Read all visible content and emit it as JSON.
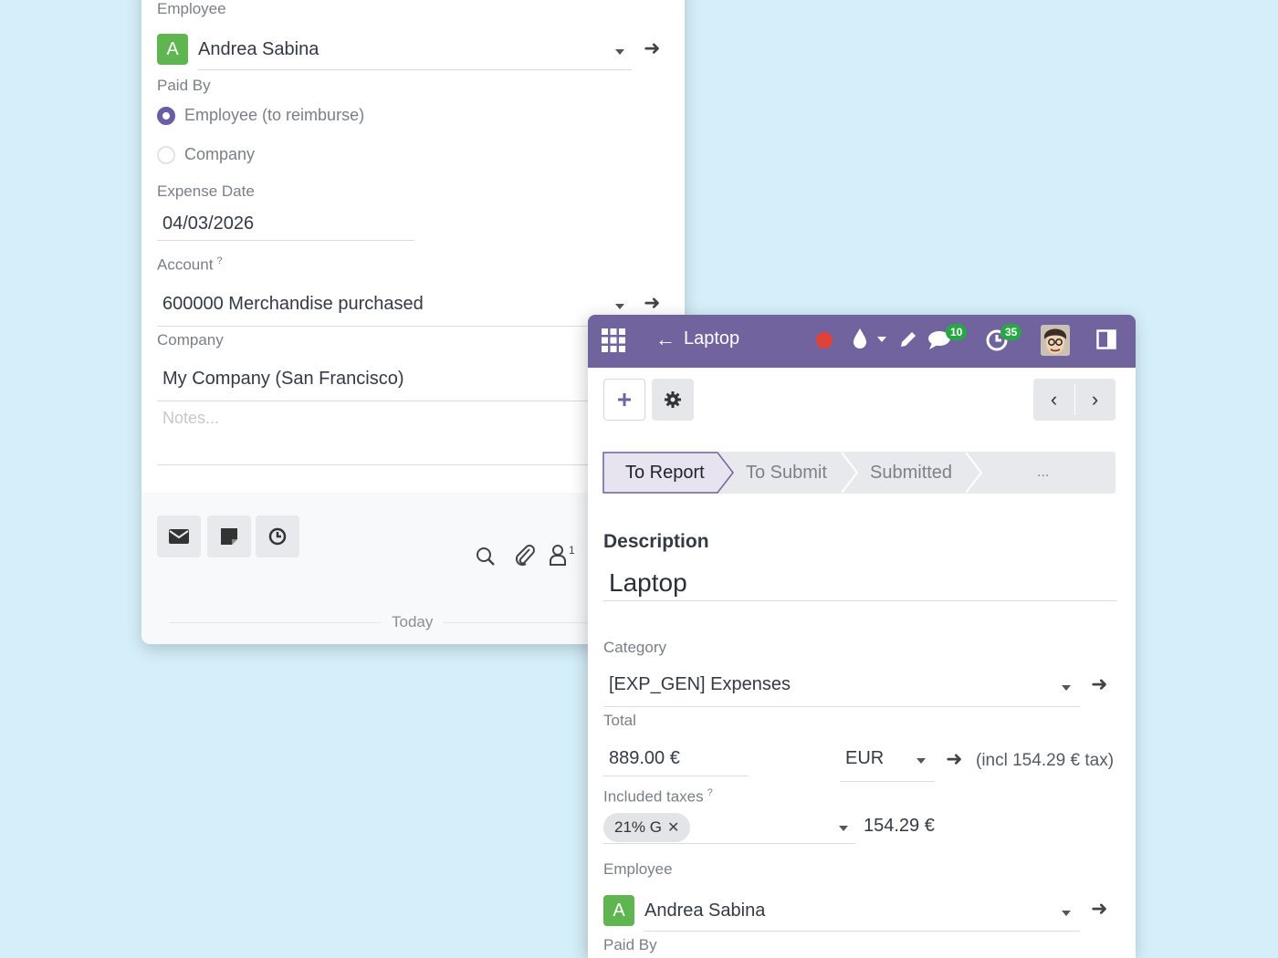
{
  "back": {
    "employee_label": "Employee",
    "employee_initial": "A",
    "employee_value": "Andrea Sabina",
    "paid_by_label": "Paid By",
    "paid_by_options": [
      "Employee (to reimburse)",
      "Company"
    ],
    "expense_date_label": "Expense Date",
    "expense_date_value": "04/03/2026",
    "account_label": "Account",
    "account_help": "?",
    "account_value": "600000 Merchandise purchased",
    "company_label": "Company",
    "company_value": "My Company (San Francisco)",
    "notes_placeholder": "Notes...",
    "follower_count": "1",
    "today_label": "Today"
  },
  "front": {
    "breadcrumb": "Laptop",
    "messages_count": "10",
    "activities_count": "35",
    "statuses": [
      "To Report",
      "To Submit",
      "Submitted",
      "..."
    ],
    "description_label": "Description",
    "description_value": "Laptop",
    "category_label": "Category",
    "category_value": "[EXP_GEN] Expenses",
    "total_label": "Total",
    "total_value": "889.00 €",
    "currency_value": "EUR",
    "tax_note": "(incl 154.29 € tax)",
    "included_taxes_label": "Included taxes",
    "included_taxes_help": "?",
    "tax_tag": "21% G",
    "tax_amount": "154.29 €",
    "employee_label": "Employee",
    "employee_initial": "A",
    "employee_value": "Andrea Sabina",
    "paid_by_label": "Paid By"
  },
  "colors": {
    "brand": "#71639e",
    "avatar": "#5fb54f",
    "badge": "#28a745",
    "record": "#e0423a"
  }
}
